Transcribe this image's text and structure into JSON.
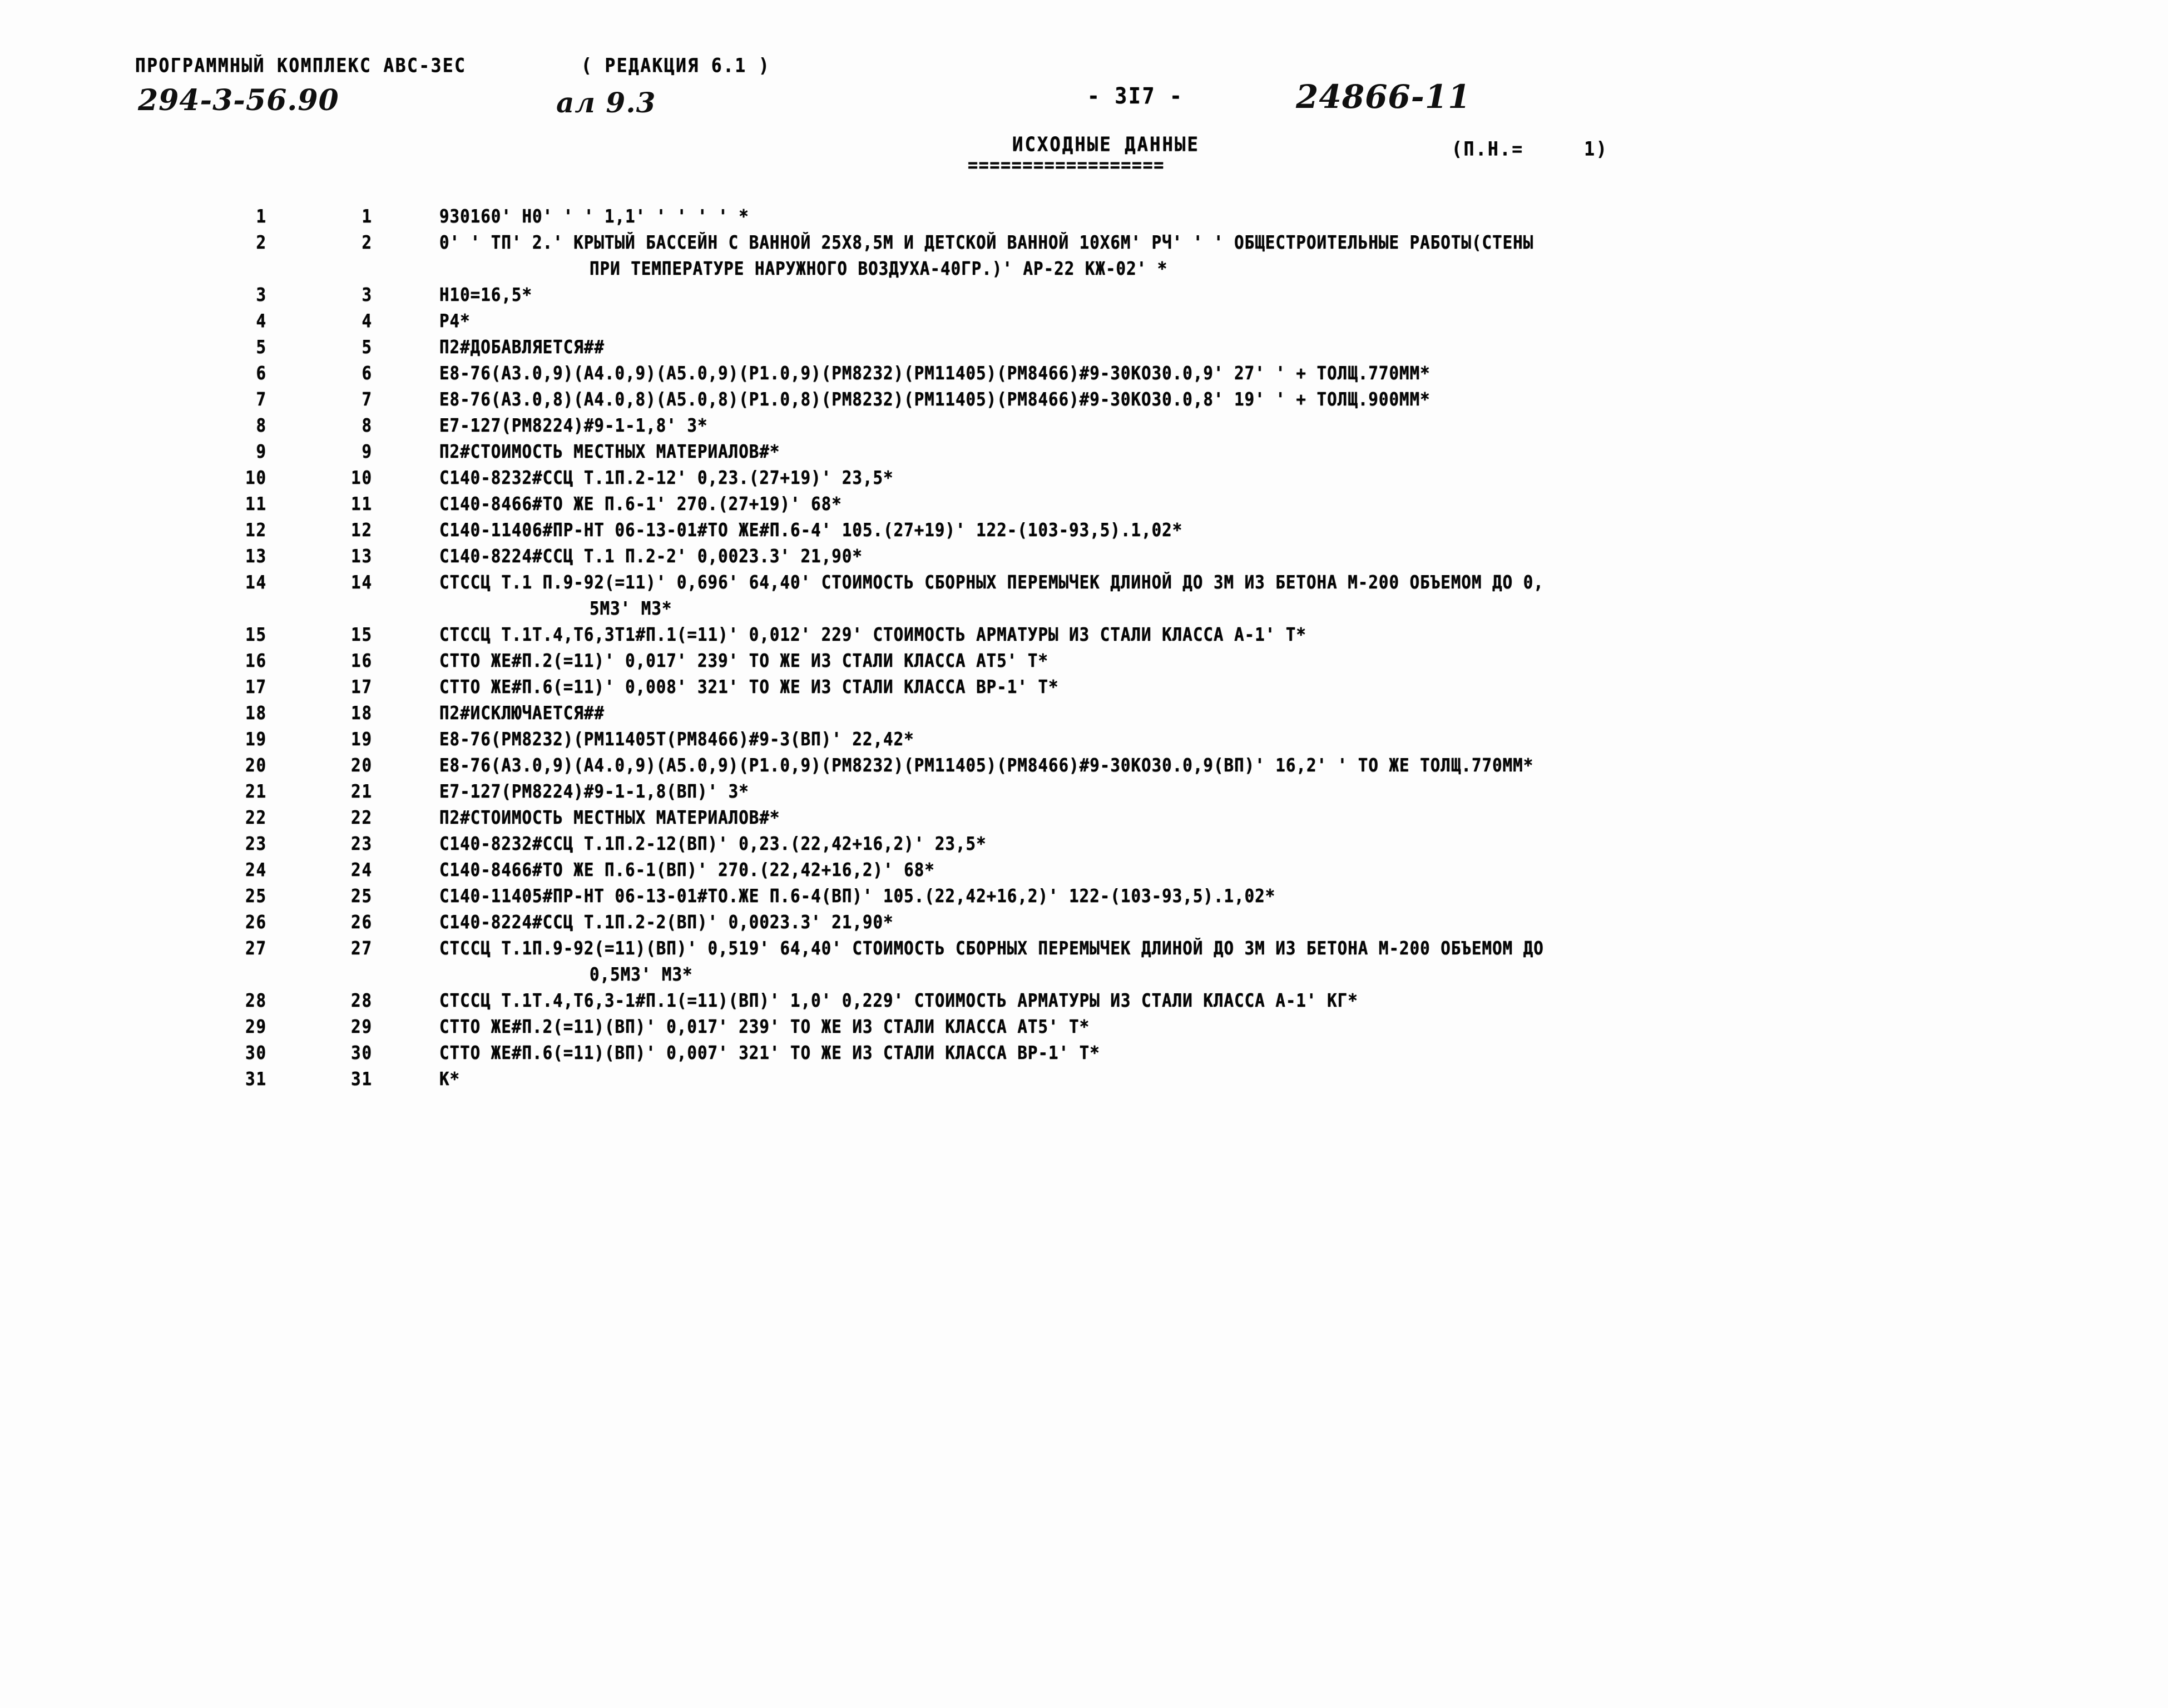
{
  "header": {
    "program_title": "ПРОГРАММНЫЙ КОМПЛЕКС АВС-ЗЕС",
    "edition": "( РЕДАКЦИЯ 6.1 )",
    "doc_code_handwritten": "294-3-56.90",
    "sheet_mark_handwritten": "ал 9.3",
    "page_number": "- 3I7 -",
    "archive_stamp_handwritten": "24866-11",
    "section_title": "ИСХОДНЫЕ ДАННЫЕ",
    "section_rule": "==================",
    "section_note": "(П.Н.=     1)"
  },
  "listing": {
    "rows": [
      {
        "a": "1",
        "b": "1",
        "text": "930160' Н0' ' ' 1,1' ' ' ' ' *",
        "cont": false
      },
      {
        "a": "2",
        "b": "2",
        "text": "0' ' ТП' 2.' КРЫТЫЙ БАССЕЙН С ВАННОЙ 25Х8,5М И ДЕТСКОЙ ВАННОЙ 10Х6М' РЧ' ' ' ОБЩЕСТРОИТЕЛЬНЫЕ РАБОТЫ(СТЕНЫ",
        "cont": false
      },
      {
        "a": "",
        "b": "",
        "text": "ПРИ ТЕМПЕРАТУРЕ НАРУЖНОГО ВОЗДУХА-40ГР.)' АР-22 КЖ-02' *",
        "cont": true
      },
      {
        "a": "3",
        "b": "3",
        "text": "Н10=16,5*",
        "cont": false
      },
      {
        "a": "4",
        "b": "4",
        "text": "Р4*",
        "cont": false
      },
      {
        "a": "5",
        "b": "5",
        "text": "П2#ДОБАВЛЯЕТСЯ##",
        "cont": false
      },
      {
        "a": "6",
        "b": "6",
        "text": "Е8-76(А3.0,9)(А4.0,9)(А5.0,9)(Р1.0,9)(РМ8232)(РМ11405)(РМ8466)#9-30КОЗ0.0,9' 27' ' + ТОЛЩ.770ММ*",
        "cont": false
      },
      {
        "a": "7",
        "b": "7",
        "text": "Е8-76(А3.0,8)(А4.0,8)(А5.0,8)(Р1.0,8)(РМ8232)(РМ11405)(РМ8466)#9-30КОЗ0.0,8' 19' ' + ТОЛЩ.900ММ*",
        "cont": false
      },
      {
        "a": "8",
        "b": "8",
        "text": "Е7-127(РМ8224)#9-1-1,8' 3*",
        "cont": false
      },
      {
        "a": "9",
        "b": "9",
        "text": "П2#СТОИМОСТЬ МЕСТНЫХ МАТЕРИАЛОВ#*",
        "cont": false
      },
      {
        "a": "10",
        "b": "10",
        "text": "С140-8232#ССЦ Т.1П.2-12' 0,23.(27+19)' 23,5*",
        "cont": false
      },
      {
        "a": "11",
        "b": "11",
        "text": "С140-8466#ТО ЖЕ П.6-1' 270.(27+19)' 68*",
        "cont": false
      },
      {
        "a": "12",
        "b": "12",
        "text": "С140-11406#ПР-НТ 06-13-01#ТО ЖЕ#П.6-4' 105.(27+19)' 122-(103-93,5).1,02*",
        "cont": false
      },
      {
        "a": "13",
        "b": "13",
        "text": "С140-8224#ССЦ Т.1 П.2-2' 0,0023.3' 21,90*",
        "cont": false
      },
      {
        "a": "14",
        "b": "14",
        "text": "СТССЦ Т.1 П.9-92(=11)' 0,696' 64,40' СТОИМОСТЬ СБОРНЫХ ПЕРЕМЫЧЕК ДЛИНОЙ ДО 3М ИЗ БЕТОНА М-200 ОБЪЕМОМ ДО 0,",
        "cont": false
      },
      {
        "a": "",
        "b": "",
        "text": "5М3' М3*",
        "cont": true
      },
      {
        "a": "15",
        "b": "15",
        "text": "СТССЦ Т.1Т.4,Т6,3Т1#П.1(=11)' 0,012' 229' СТОИМОСТЬ АРМАТУРЫ ИЗ СТАЛИ КЛАССА А-1' Т*",
        "cont": false
      },
      {
        "a": "16",
        "b": "16",
        "text": "СТТО ЖЕ#П.2(=11)' 0,017' 239' ТО ЖЕ ИЗ СТАЛИ КЛАССА АТ5' Т*",
        "cont": false
      },
      {
        "a": "17",
        "b": "17",
        "text": "СТТО ЖЕ#П.6(=11)' 0,008' 321' ТО ЖЕ ИЗ СТАЛИ КЛАССА ВР-1' Т*",
        "cont": false
      },
      {
        "a": "18",
        "b": "18",
        "text": "П2#ИСКЛЮЧАЕТСЯ##",
        "cont": false
      },
      {
        "a": "19",
        "b": "19",
        "text": "Е8-76(РМ8232)(РМ11405Т(РМ8466)#9-3(ВП)' 22,42*",
        "cont": false
      },
      {
        "a": "20",
        "b": "20",
        "text": "Е8-76(А3.0,9)(А4.0,9)(А5.0,9)(Р1.0,9)(РМ8232)(РМ11405)(РМ8466)#9-30КОЗ0.0,9(ВП)' 16,2' ' ТО ЖЕ ТОЛЩ.770ММ*",
        "cont": false
      },
      {
        "a": "21",
        "b": "21",
        "text": "Е7-127(РМ8224)#9-1-1,8(ВП)' 3*",
        "cont": false
      },
      {
        "a": "22",
        "b": "22",
        "text": "П2#СТОИМОСТЬ МЕСТНЫХ МАТЕРИАЛОВ#*",
        "cont": false
      },
      {
        "a": "23",
        "b": "23",
        "text": "С140-8232#ССЦ Т.1П.2-12(ВП)' 0,23.(22,42+16,2)' 23,5*",
        "cont": false
      },
      {
        "a": "24",
        "b": "24",
        "text": "С140-8466#ТО ЖЕ П.6-1(ВП)' 270.(22,42+16,2)' 68*",
        "cont": false
      },
      {
        "a": "25",
        "b": "25",
        "text": "С140-11405#ПР-НТ 06-13-01#ТО.ЖЕ П.6-4(ВП)' 105.(22,42+16,2)' 122-(103-93,5).1,02*",
        "cont": false
      },
      {
        "a": "26",
        "b": "26",
        "text": "С140-8224#ССЦ Т.1П.2-2(ВП)' 0,0023.3' 21,90*",
        "cont": false
      },
      {
        "a": "27",
        "b": "27",
        "text": "СТССЦ Т.1П.9-92(=11)(ВП)' 0,519' 64,40' СТОИМОСТЬ СБОРНЫХ ПЕРЕМЫЧЕК ДЛИНОЙ ДО 3М ИЗ БЕТОНА М-200 ОБЪЕМОМ ДО",
        "cont": false
      },
      {
        "a": "",
        "b": "",
        "text": "0,5М3' М3*",
        "cont": true
      },
      {
        "a": "28",
        "b": "28",
        "text": "СТССЦ Т.1Т.4,Т6,3-1#П.1(=11)(ВП)' 1,0' 0,229' СТОИМОСТЬ АРМАТУРЫ ИЗ СТАЛИ КЛАССА А-1' КГ*",
        "cont": false
      },
      {
        "a": "29",
        "b": "29",
        "text": "СТТО ЖЕ#П.2(=11)(ВП)' 0,017' 239' ТО ЖЕ ИЗ СТАЛИ КЛАССА АТ5' Т*",
        "cont": false
      },
      {
        "a": "30",
        "b": "30",
        "text": "СТТО ЖЕ#П.6(=11)(ВП)' 0,007' 321' ТО ЖЕ ИЗ СТАЛИ КЛАССА ВР-1' Т*",
        "cont": false
      },
      {
        "a": "31",
        "b": "31",
        "text": "К*",
        "cont": false
      }
    ]
  }
}
